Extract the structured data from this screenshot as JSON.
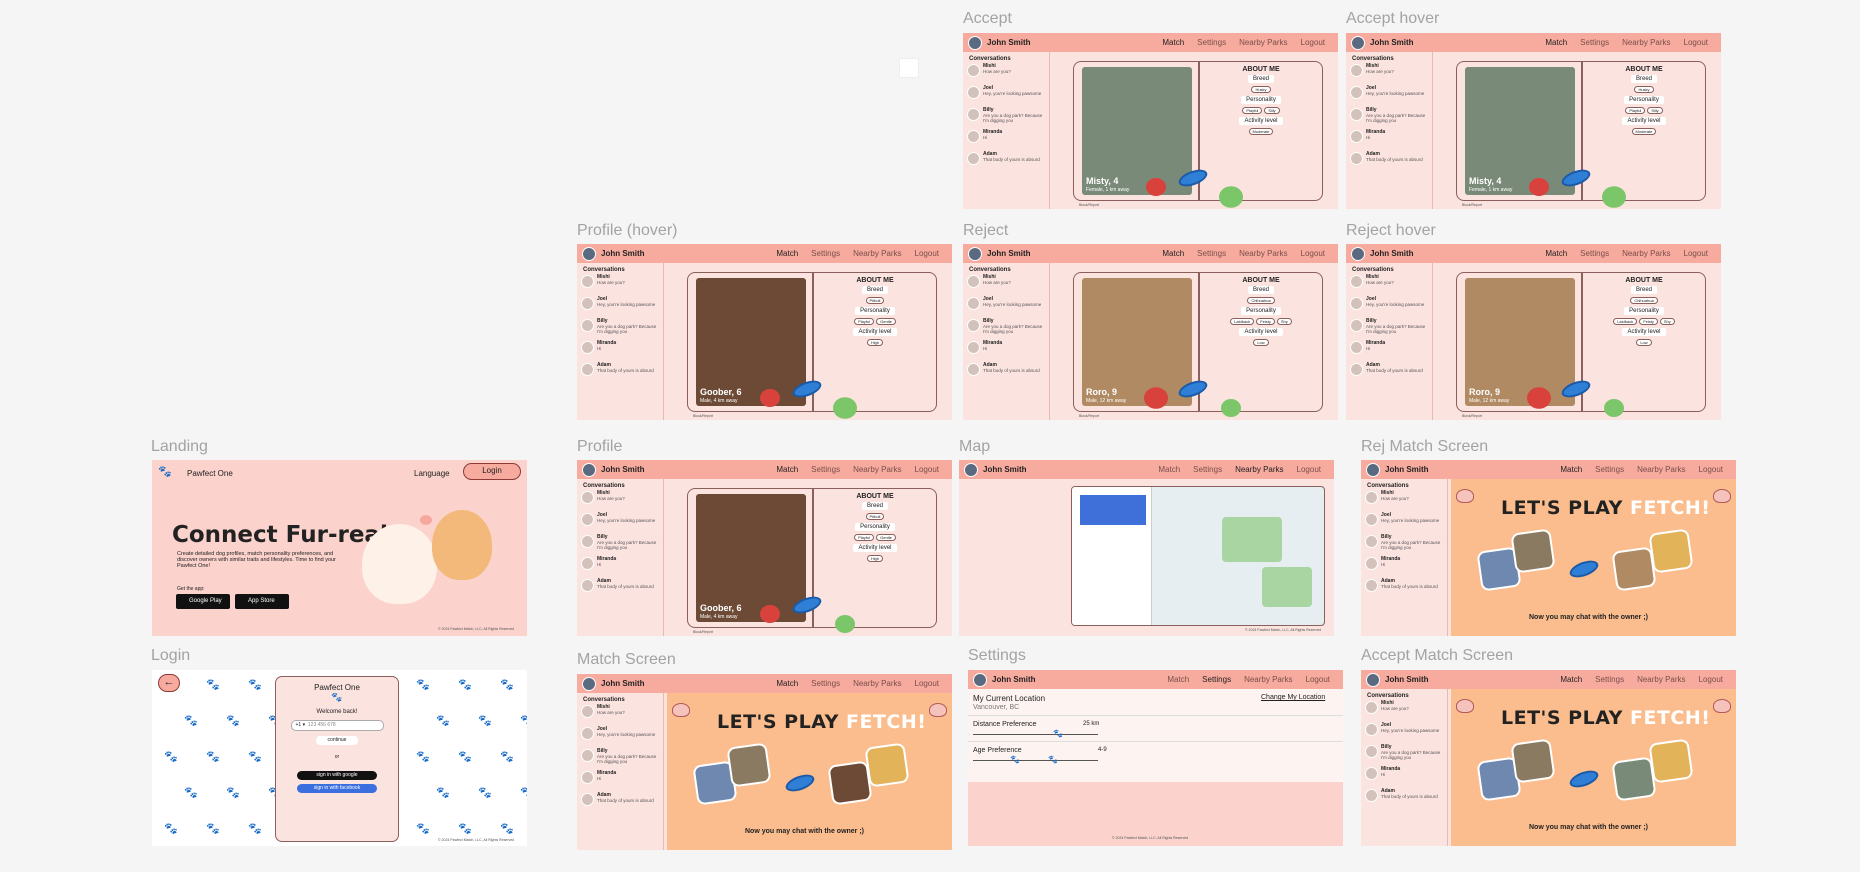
{
  "frames": {
    "accept": "Accept",
    "accept_hover": "Accept hover",
    "profile_hover": "Profile (hover)",
    "reject": "Reject",
    "reject_hover": "Reject hover",
    "landing": "Landing",
    "profile": "Profile",
    "map": "Map",
    "rej_match": "Rej Match Screen",
    "login": "Login",
    "match_screen": "Match Screen",
    "settings": "Settings",
    "accept_match": "Accept Match Screen"
  },
  "header": {
    "user": "John Smith",
    "nav": [
      "Match",
      "Settings",
      "Nearby Parks",
      "Logout"
    ]
  },
  "sidebar": {
    "title": "Conversations",
    "items": [
      {
        "name": "Mishi",
        "msg": "How are you?"
      },
      {
        "name": "Joel",
        "msg": "Hey, you're looking pawsome"
      },
      {
        "name": "Billy",
        "msg": "Are you a dog park? Because I'm digging you"
      },
      {
        "name": "Miranda",
        "msg": "Hi"
      },
      {
        "name": "Adam",
        "msg": "That body of yours is absurd"
      }
    ]
  },
  "profiles": {
    "misty": {
      "name": "Misty, 4",
      "sub": "Female, 1 km away",
      "breed": "Husky",
      "traits": [
        "Playful",
        "Silly"
      ],
      "activity": "Moderate"
    },
    "goober": {
      "name": "Goober, 6",
      "sub": "Male, 4 km away",
      "breed": "Pitbull",
      "traits": [
        "Playful",
        "Gentle"
      ],
      "activity": "High"
    },
    "roro": {
      "name": "Roro, 9",
      "sub": "Male, 12 km away",
      "breed": "Chihuahua",
      "traits": [
        "Laidback",
        "Feisty",
        "Shy"
      ],
      "activity": "Low"
    }
  },
  "about": {
    "title": "ABOUT ME",
    "breed": "Breed",
    "personality": "Personality",
    "activity": "Activity level"
  },
  "block_report": "Block/Report",
  "landing": {
    "brand": "Pawfect One",
    "language": "Language",
    "login": "Login",
    "headline": "Connect Fur-real.",
    "body": "Create detailed dog profiles, match personality preferences, and discover owners with similar traits and lifestyles. Time to find your Pawfect One!",
    "get_app": "Get the app:",
    "google_play": "Google Play",
    "app_store": "App Store",
    "copyright": "© 2024 Pawfect Match, LLC, All Rights Reserved"
  },
  "login": {
    "title": "Pawfect One",
    "welcome": "Welcome back!",
    "phone_prefix": "+1 ▾",
    "phone_placeholder": "123 456 678",
    "continue": "continue",
    "or": "or",
    "google": "sign in with google",
    "facebook": "sign in with facebook",
    "copyright": "© 2024 Pawfect Match, LLC, All Rights Reserved"
  },
  "match": {
    "lets_play": "LET'S PLAY",
    "fetch": "FETCH!",
    "chat": "Now you may chat with the owner ;)"
  },
  "settings": {
    "location_label": "My Current Location",
    "change": "Change My Location",
    "location_value": "Vancouver, BC",
    "distance_label": "Distance Preference",
    "distance_value": "25 km",
    "age_label": "Age Preference",
    "age_value": "4-9",
    "copyright": "© 2024 Pawfect Match, LLC, All Rights Reserved"
  },
  "map": {
    "copyright": "© 2024 Pawfect Match, LLC, All Rights Reserved"
  },
  "colors": {
    "header": "#f7aa9e",
    "background": "#fbe3df",
    "banner": "#fbbd8d",
    "accent": "#8b5f5b"
  }
}
